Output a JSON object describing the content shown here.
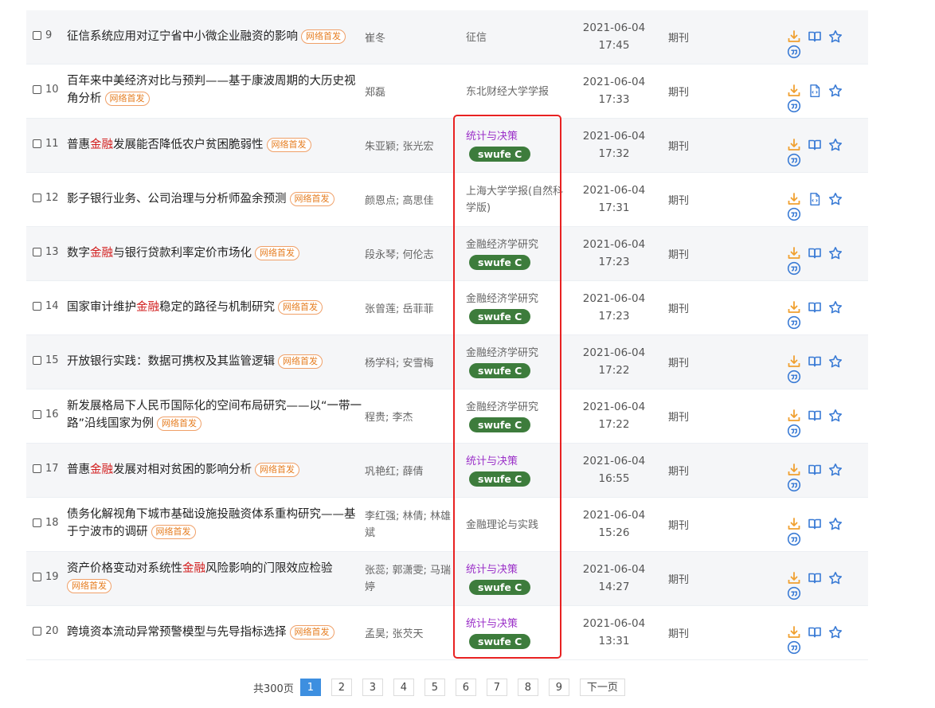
{
  "badge_label": "网络首发",
  "rows": [
    {
      "num": "9",
      "title": [
        {
          "t": "征信系统应用对辽宁省中小微企业融资的影响"
        }
      ],
      "authors": "崔冬",
      "source": "征信",
      "swufe": null,
      "date": "2021-06-04",
      "time": "17:45",
      "type": "期刊",
      "reader": "book"
    },
    {
      "num": "10",
      "title": [
        {
          "t": "百年来中美经济对比与预判——基于康波周期的大历史视角分析"
        }
      ],
      "authors": "郑磊",
      "source": "东北财经大学学报",
      "swufe": null,
      "date": "2021-06-04",
      "time": "17:33",
      "type": "期刊",
      "reader": "html"
    },
    {
      "num": "11",
      "title": [
        {
          "t": "普惠"
        },
        {
          "t": "金融",
          "hl": true
        },
        {
          "t": "发展能否降低农户贫困脆弱性"
        }
      ],
      "authors": "朱亚颖; 张光宏",
      "source": "统计与决策",
      "swufe": "swufe C",
      "date": "2021-06-04",
      "time": "17:32",
      "type": "期刊",
      "reader": "book"
    },
    {
      "num": "12",
      "title": [
        {
          "t": "影子银行业务、公司治理与分析师盈余预测"
        }
      ],
      "authors": "颜恩点; 高思佳",
      "source": "上海大学学报(自然科学版)",
      "swufe": null,
      "date": "2021-06-04",
      "time": "17:31",
      "type": "期刊",
      "reader": "html"
    },
    {
      "num": "13",
      "title": [
        {
          "t": "数字"
        },
        {
          "t": "金融",
          "hl": true
        },
        {
          "t": "与银行贷款利率定价市场化"
        }
      ],
      "authors": "段永琴; 何伦志",
      "source": "金融经济学研究",
      "swufe": "swufe C",
      "date": "2021-06-04",
      "time": "17:23",
      "type": "期刊",
      "reader": "book"
    },
    {
      "num": "14",
      "title": [
        {
          "t": "国家审计维护"
        },
        {
          "t": "金融",
          "hl": true
        },
        {
          "t": "稳定的路径与机制研究"
        }
      ],
      "authors": "张曾莲; 岳菲菲",
      "source": "金融经济学研究",
      "swufe": "swufe C",
      "date": "2021-06-04",
      "time": "17:23",
      "type": "期刊",
      "reader": "book"
    },
    {
      "num": "15",
      "title": [
        {
          "t": "开放银行实践：数据可携权及其监管逻辑"
        }
      ],
      "authors": "杨学科; 安雪梅",
      "source": "金融经济学研究",
      "swufe": "swufe C",
      "date": "2021-06-04",
      "time": "17:22",
      "type": "期刊",
      "reader": "book"
    },
    {
      "num": "16",
      "title": [
        {
          "t": "新发展格局下人民币国际化的空间布局研究——以“一带一路”沿线国家为例"
        }
      ],
      "authors": "程贵; 李杰",
      "source": "金融经济学研究",
      "swufe": "swufe C",
      "date": "2021-06-04",
      "time": "17:22",
      "type": "期刊",
      "reader": "book"
    },
    {
      "num": "17",
      "title": [
        {
          "t": "普惠"
        },
        {
          "t": "金融",
          "hl": true
        },
        {
          "t": "发展对相对贫困的影响分析"
        }
      ],
      "authors": "巩艳红; 薛倩",
      "source": "统计与决策",
      "swufe": "swufe C",
      "date": "2021-06-04",
      "time": "16:55",
      "type": "期刊",
      "reader": "book"
    },
    {
      "num": "18",
      "title": [
        {
          "t": "债务化解视角下城市基础设施投融资体系重构研究——基于宁波市的调研"
        }
      ],
      "authors": "李红强; 林倩; 林雄斌",
      "source": "金融理论与实践",
      "swufe": null,
      "date": "2021-06-04",
      "time": "15:26",
      "type": "期刊",
      "reader": "book"
    },
    {
      "num": "19",
      "title": [
        {
          "t": "资产价格变动对系统性"
        },
        {
          "t": "金融",
          "hl": true
        },
        {
          "t": "风险影响的门限效应检验"
        }
      ],
      "authors": "张蕊; 郭潇雯; 马瑞婷",
      "source": "统计与决策",
      "swufe": "swufe C",
      "date": "2021-06-04",
      "time": "14:27",
      "type": "期刊",
      "reader": "book"
    },
    {
      "num": "20",
      "title": [
        {
          "t": "跨境资本流动异常预警模型与先导指标选择"
        }
      ],
      "authors": "孟昊; 张芡天",
      "source": "统计与决策",
      "swufe": "swufe C",
      "date": "2021-06-04",
      "time": "13:31",
      "type": "期刊",
      "reader": "book"
    }
  ],
  "pagination": {
    "total_label": "共300页",
    "pages": [
      "1",
      "2",
      "3",
      "4",
      "5",
      "6",
      "7",
      "8",
      "9"
    ],
    "current": "1",
    "next_label": "下一页"
  },
  "colors": {
    "download": "#f0a030",
    "read": "#3a7bd5",
    "favorite": "#3a7bd5",
    "cite": "#3a7bd5",
    "highlight": "#d21f1f",
    "swufe_bg": "#3d7c3c",
    "purple_source": "#9b30c8",
    "redbox": "#e82222"
  },
  "icons": {
    "download": "download-icon",
    "book": "book-icon",
    "html": "html-reader-icon",
    "favorite": "star-icon",
    "cite": "quote-icon"
  }
}
